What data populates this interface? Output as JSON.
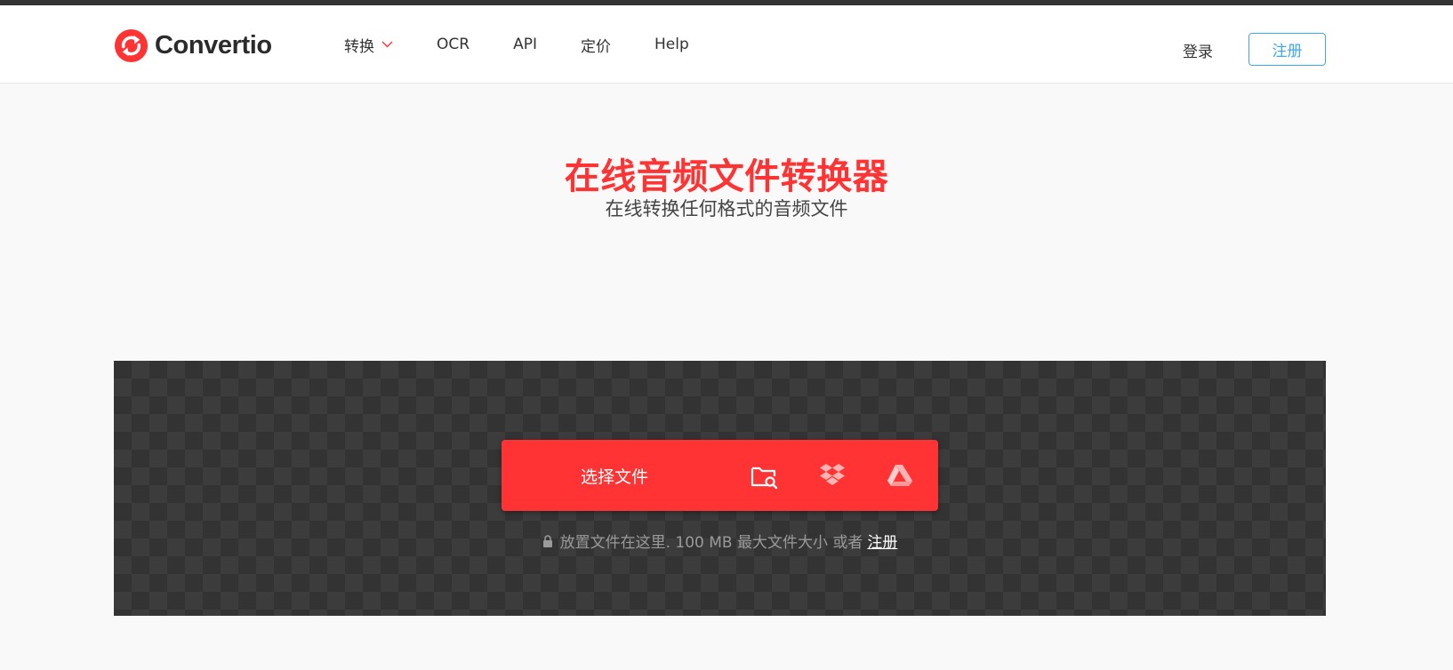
{
  "brand": {
    "name": "Convertio",
    "accent_color": "#ff3333",
    "link_color": "#3fa9e8",
    "logo_icon": "convertio-logo-icon"
  },
  "nav": {
    "items": [
      {
        "label": "转换",
        "has_dropdown": true
      },
      {
        "label": "OCR"
      },
      {
        "label": "API"
      },
      {
        "label": "定价"
      },
      {
        "label": "Help"
      }
    ],
    "login_label": "登录",
    "signup_label": "注册"
  },
  "hero": {
    "title": "在线音频文件转换器",
    "subtitle": "在线转换任何格式的音频文件"
  },
  "upload": {
    "choose_label": "选择文件",
    "sources": [
      {
        "name": "local-folder-search-icon"
      },
      {
        "name": "dropbox-icon"
      },
      {
        "name": "google-drive-icon"
      }
    ],
    "note_text": "放置文件在这里. 100 MB 最大文件大小 或者",
    "note_link": "注册"
  }
}
